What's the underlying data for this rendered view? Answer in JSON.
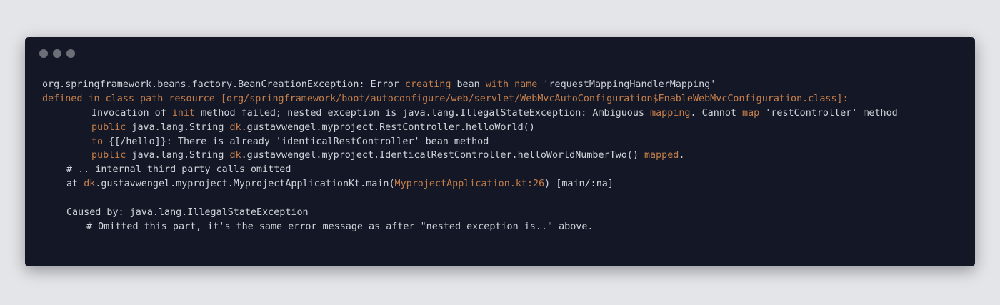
{
  "window": {
    "traffic_lights": [
      "close-dot",
      "minimize-dot",
      "zoom-dot"
    ]
  },
  "code_lines": [
    {
      "indent": 0,
      "segments": [
        {
          "t": "org.springframework.beans.factory.BeanCreationException: Error ",
          "c": "plain"
        },
        {
          "t": "creating",
          "c": "kw"
        },
        {
          "t": " bean ",
          "c": "plain"
        },
        {
          "t": "with",
          "c": "kw"
        },
        {
          "t": " ",
          "c": "plain"
        },
        {
          "t": "name",
          "c": "kw"
        },
        {
          "t": " 'requestMappingHandlerMapping'",
          "c": "plain"
        }
      ]
    },
    {
      "indent": 0,
      "segments": [
        {
          "t": "defined",
          "c": "kw"
        },
        {
          "t": " ",
          "c": "plain"
        },
        {
          "t": "in",
          "c": "kw"
        },
        {
          "t": " class path resource [org/springframework/boot/autoconfigure/web/servlet/WebMvcAutoConfiguration$EnableWebMvcConfiguration.class]:",
          "c": "kw"
        }
      ]
    },
    {
      "indent": 2,
      "segments": [
        {
          "t": "Invocation of ",
          "c": "plain"
        },
        {
          "t": "init",
          "c": "kw"
        },
        {
          "t": " method failed; nested exception is java.lang.IllegalStateException: Ambiguous ",
          "c": "plain"
        },
        {
          "t": "mapping",
          "c": "kw"
        },
        {
          "t": ". Cannot ",
          "c": "plain"
        },
        {
          "t": "map",
          "c": "kw"
        },
        {
          "t": " 'restController' method",
          "c": "plain"
        }
      ]
    },
    {
      "indent": 2,
      "segments": [
        {
          "t": "public",
          "c": "kw"
        },
        {
          "t": " java.lang.String ",
          "c": "plain"
        },
        {
          "t": "dk",
          "c": "kw"
        },
        {
          "t": ".gustavwengel.myproject.RestController.helloWorld()",
          "c": "plain"
        }
      ]
    },
    {
      "indent": 2,
      "segments": [
        {
          "t": "to",
          "c": "kw"
        },
        {
          "t": " {[/hello]}: There is already 'identicalRestController' bean method",
          "c": "plain"
        }
      ]
    },
    {
      "indent": 2,
      "segments": [
        {
          "t": "public",
          "c": "kw"
        },
        {
          "t": " java.lang.String ",
          "c": "plain"
        },
        {
          "t": "dk",
          "c": "kw"
        },
        {
          "t": ".gustavwengel.myproject.IdenticalRestController.helloWorldNumberTwo() ",
          "c": "plain"
        },
        {
          "t": "mapped",
          "c": "kw"
        },
        {
          "t": ".",
          "c": "plain"
        }
      ]
    },
    {
      "indent": 1,
      "segments": [
        {
          "t": "# .. internal third party calls omitted",
          "c": "plain"
        }
      ]
    },
    {
      "indent": 1,
      "segments": [
        {
          "t": "at ",
          "c": "plain"
        },
        {
          "t": "dk",
          "c": "kw"
        },
        {
          "t": ".gustavwengel.myproject.MyprojectApplicationKt.main(",
          "c": "plain"
        },
        {
          "t": "MyprojectApplication.kt:26",
          "c": "kw"
        },
        {
          "t": ") [main/:na]",
          "c": "plain"
        }
      ]
    },
    {
      "indent": -1,
      "segments": []
    },
    {
      "indent": 1,
      "segments": [
        {
          "t": "Caused by: java.lang.IllegalStateException",
          "c": "plain"
        }
      ]
    },
    {
      "indent": 3,
      "segments": [
        {
          "t": "# Omitted this part, it's the same error message as after \"nested exception is..\" above.",
          "c": "plain"
        }
      ]
    }
  ],
  "colors": {
    "background": "#e4e5e9",
    "window": "#141826",
    "text": "#cfd2d8",
    "keyword": "#c57e4a",
    "dot": "#6d6f77"
  }
}
